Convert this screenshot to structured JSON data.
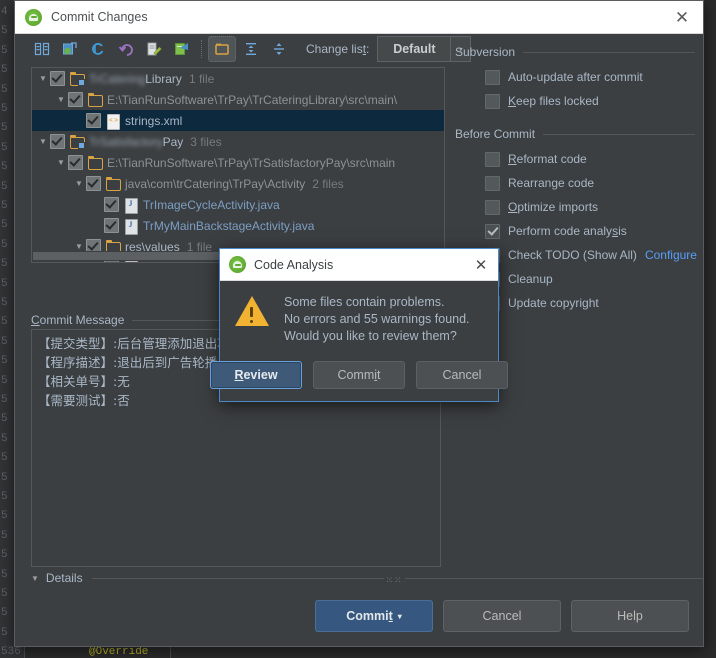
{
  "backdrop": {
    "gutter_numbers": [
      "4",
      "5",
      "5",
      "5",
      "5",
      "5",
      "5",
      "5",
      "5",
      "5",
      "5",
      "5",
      "5",
      "5",
      "5",
      "5",
      "5",
      "5",
      "5",
      "5",
      "5",
      "5",
      "5",
      "5",
      "5",
      "5",
      "5",
      "5",
      "5",
      "5",
      "5",
      "5",
      "5"
    ],
    "last_line_number": "536",
    "code_snippet": "@Override"
  },
  "window": {
    "title": "Commit Changes",
    "icon": "android-studio-icon",
    "close_label": "✕"
  },
  "toolbar": {
    "buttons": [
      {
        "name": "show-diff-icon",
        "glyph": "diff"
      },
      {
        "name": "move-to-another-changelist-icon",
        "glyph": "move"
      },
      {
        "name": "refresh-icon",
        "glyph": "refresh"
      },
      {
        "name": "revert-icon",
        "glyph": "revert"
      },
      {
        "name": "edit-source-icon",
        "glyph": "edit"
      },
      {
        "name": "show-ignored-icon",
        "glyph": "ignored"
      },
      {
        "name": "group-by-directory-icon",
        "glyph": "group",
        "selected": true
      },
      {
        "name": "expand-all-icon",
        "glyph": "expand"
      },
      {
        "name": "collapse-all-icon",
        "glyph": "collapse"
      }
    ],
    "changelist_label": "Change list:",
    "changelist_value": "Default",
    "changelist_arrow": "▾"
  },
  "tree": {
    "rows": [
      {
        "indent": 0,
        "twisty": "▼",
        "checked": true,
        "icon": "module-folder-icon",
        "blur_text": "TrCatering",
        "text": "Library",
        "count": "1 file",
        "selected": false,
        "blurred_prefix": true
      },
      {
        "indent": 1,
        "twisty": "▼",
        "checked": true,
        "icon": "folder-icon",
        "text": "E:\\TianRunSoftware\\TrPay\\TrCateringLibrary\\src\\main\\",
        "path": true,
        "selected": false
      },
      {
        "indent": 2,
        "twisty": "",
        "checked": true,
        "icon": "xml-file-icon",
        "text": "strings.xml",
        "selected": true
      },
      {
        "indent": 0,
        "twisty": "▼",
        "checked": true,
        "icon": "module-folder-icon",
        "blur_text": "TrSatisfactory",
        "text": "Pay",
        "count": "3 files",
        "selected": false,
        "blurred_prefix": true
      },
      {
        "indent": 1,
        "twisty": "▼",
        "checked": true,
        "icon": "folder-icon",
        "text": "E:\\TianRunSoftware\\TrPay\\TrSatisfactoryPay\\src\\main",
        "path": true,
        "selected": false
      },
      {
        "indent": 2,
        "twisty": "▼",
        "checked": true,
        "icon": "folder-icon",
        "text": "java\\com\\trCatering\\TrPay\\Activity",
        "count": "2 files",
        "path": true,
        "selected": false
      },
      {
        "indent": 3,
        "twisty": "",
        "checked": true,
        "icon": "java-file-icon",
        "text": "TrImageCycleActivity.java",
        "java": true,
        "selected": false
      },
      {
        "indent": 3,
        "twisty": "",
        "checked": true,
        "icon": "java-file-icon",
        "text": "TrMyMainBackstageActivity.java",
        "java": true,
        "selected": false
      },
      {
        "indent": 2,
        "twisty": "▼",
        "checked": true,
        "icon": "folder-icon",
        "text": "res\\values",
        "count": "1 file",
        "selected": false
      },
      {
        "indent": 3,
        "twisty": "",
        "checked": true,
        "icon": "xml-file-icon",
        "text": "strings.xml",
        "selected": false
      }
    ]
  },
  "options": {
    "subversion": {
      "title": "Subversion",
      "items": [
        {
          "label": "Auto-update after commit",
          "checked": false,
          "mnemonic": ""
        },
        {
          "label": "Keep files locked",
          "checked": false,
          "mnemonic": "K"
        }
      ]
    },
    "before_commit": {
      "title": "Before Commit",
      "items": [
        {
          "label": "Reformat code",
          "checked": false,
          "mnemonic": "R"
        },
        {
          "label": "Rearrange code",
          "checked": false,
          "mnemonic": "g"
        },
        {
          "label": "Optimize imports",
          "checked": false,
          "mnemonic": "O"
        },
        {
          "label": "Perform code analysis",
          "checked": true,
          "mnemonic": "s"
        },
        {
          "label": "Check TODO (Show All)",
          "checked": false,
          "mnemonic": "",
          "link": "Configure"
        },
        {
          "label": "Cleanup",
          "checked": false,
          "mnemonic": ""
        },
        {
          "label": "Update copyright",
          "checked": false,
          "mnemonic": ""
        }
      ]
    }
  },
  "commit_message": {
    "title": "Commit Message",
    "mnemonic": "C",
    "lines": [
      "【提交类型】:后台管理添加退出功能",
      "【程序描述】:退出后到广告轮播",
      "【相关单号】:无",
      "【需要测试】:否"
    ]
  },
  "details": {
    "label": "Details",
    "twisty": "▼",
    "grip": "⁙⁙"
  },
  "bottom_buttons": [
    {
      "name": "commit-button",
      "label": "Commit",
      "mnemonic": "t",
      "primary": true,
      "caret": "▾"
    },
    {
      "name": "cancel-button",
      "label": "Cancel",
      "primary": false
    },
    {
      "name": "help-button",
      "label": "Help",
      "primary": false
    }
  ],
  "code_analysis_dialog": {
    "title": "Code Analysis",
    "icon": "android-studio-icon",
    "close_label": "✕",
    "warning_icon": "warning-triangle-icon",
    "message_lines": [
      "Some files contain problems.",
      "No errors and 55 warnings found.",
      "Would you like to review them?"
    ],
    "buttons": [
      {
        "name": "review-button",
        "label": "Review",
        "mnemonic": "R",
        "default": true
      },
      {
        "name": "commit-button",
        "label": "Commit",
        "mnemonic": "i",
        "default": false
      },
      {
        "name": "cancel-button",
        "label": "Cancel",
        "mnemonic": "",
        "default": false
      }
    ]
  },
  "colors": {
    "accent_blue": "#4a88c7",
    "link_blue": "#589df6",
    "primary_button": "#365880",
    "selection": "#0d293e",
    "panel_bg": "#3c3f41",
    "warning_yellow": "#f2b333"
  }
}
